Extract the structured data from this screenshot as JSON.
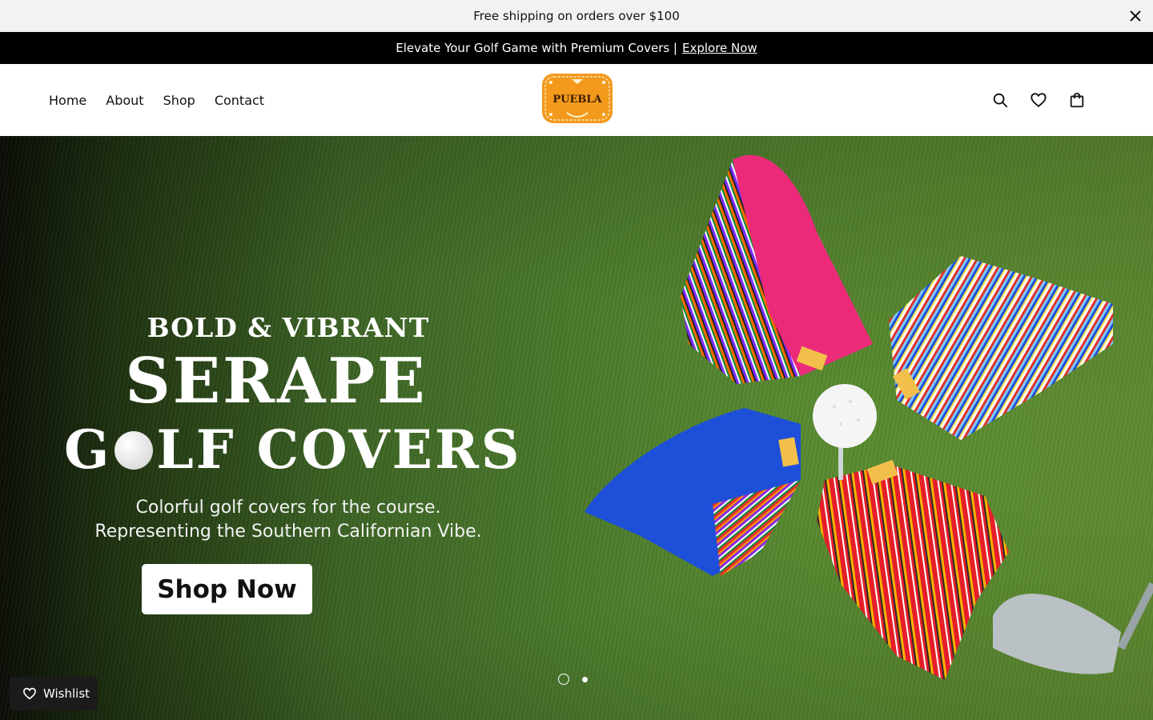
{
  "announcement": {
    "text": "Free shipping on orders over $100"
  },
  "promo": {
    "text": "Elevate Your Golf Game with Premium Covers |",
    "link": "Explore Now"
  },
  "nav": {
    "items": [
      "Home",
      "About",
      "Shop",
      "Contact"
    ]
  },
  "logo": {
    "text": "PUEBLA"
  },
  "hero": {
    "kicker": "BOLD & VIBRANT",
    "title_line1": "SERAPE",
    "title_line2_a": "G",
    "title_line2_b": "LF COVERS",
    "subtitle_line1": "Colorful golf covers for the course.",
    "subtitle_line2": "Representing the Southern Californian Vibe.",
    "cta": "Shop Now",
    "cover_tag": "PUEBLA"
  },
  "slider": {
    "active_index": 1,
    "count": 2
  },
  "wishlist_float": {
    "label": "Wishlist"
  },
  "colors": {
    "brand_orange": "#f39a1d",
    "promo_bg": "#000000",
    "topbar_bg": "#f2f2f2"
  },
  "icons": [
    "close-icon",
    "search-icon",
    "heart-icon",
    "shopping-bag-icon"
  ]
}
